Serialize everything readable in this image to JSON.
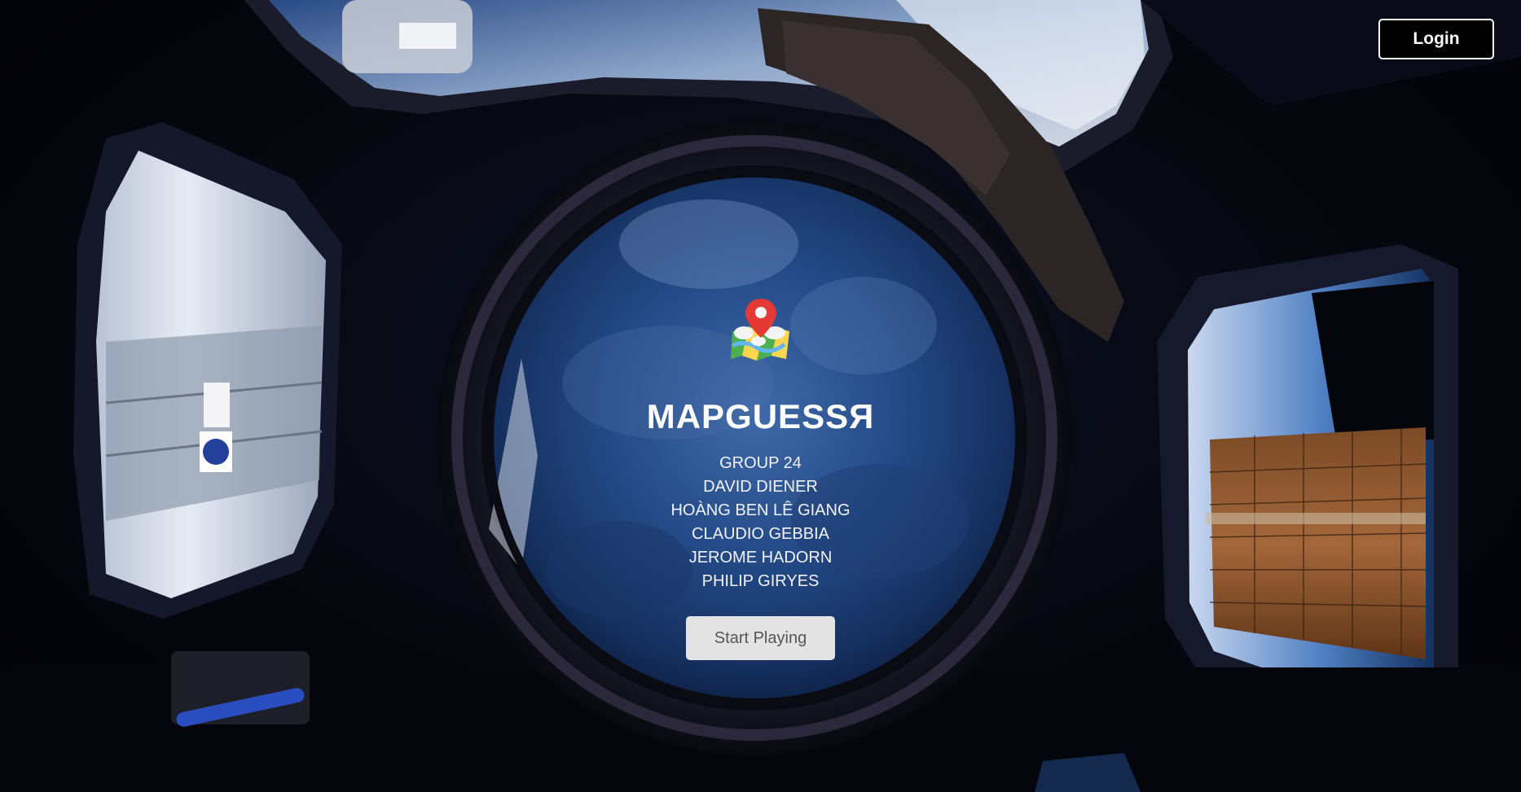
{
  "header": {
    "login_label": "Login"
  },
  "hero": {
    "logo_icon": "map-pin-icon",
    "title": "MAPGUESSЯ",
    "members": [
      "GROUP 24",
      "DAVID DIENER",
      "HOÀNG BEN LÊ GIANG",
      "CLAUDIO GEBBIA",
      "JEROME HADORN",
      "PHILIP GIRYES"
    ],
    "start_label": "Start Playing"
  },
  "colors": {
    "background": "#05060d",
    "earth_blue": "#1f3f7a",
    "button_bg": "#e3e3e3",
    "button_text": "#555555",
    "text": "#ffffff"
  }
}
